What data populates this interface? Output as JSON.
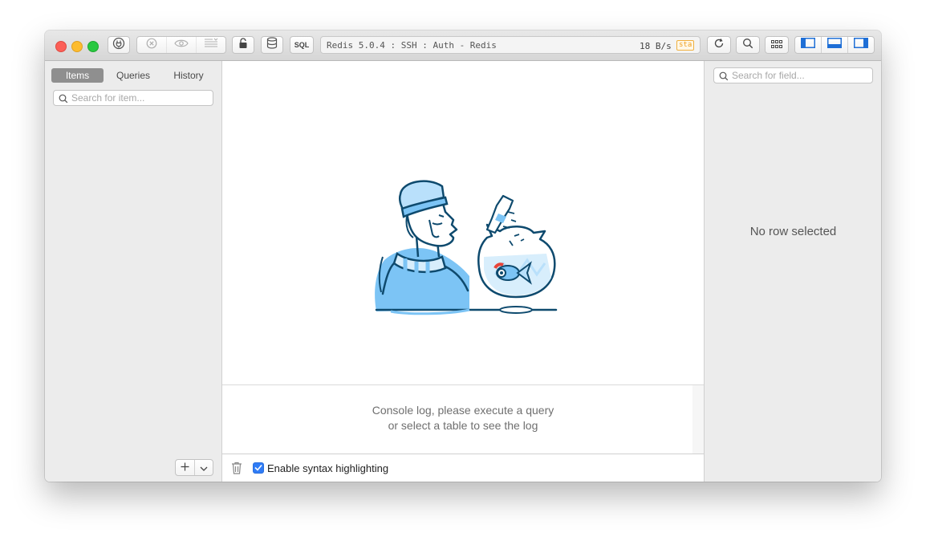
{
  "window": {
    "connection_label": "Redis 5.0.4 : SSH : Auth - Redis",
    "transfer_rate": "18 B/s",
    "env_badge": "sta",
    "env_badge_color": "#f0a020"
  },
  "toolbar": {
    "sql_label": "SQL",
    "icons": [
      "connection-icon",
      "stop-icon",
      "preview-icon",
      "format-icon",
      "lock-icon",
      "database-icon",
      "sql-icon",
      "refresh-icon",
      "search-icon",
      "grid-icon",
      "toggle-left-panel-icon",
      "toggle-bottom-panel-icon",
      "toggle-right-panel-icon"
    ]
  },
  "sidebar": {
    "tabs": [
      {
        "label": "Items",
        "active": true
      },
      {
        "label": "Queries",
        "active": false
      },
      {
        "label": "History",
        "active": false
      }
    ],
    "search_placeholder": "Search for item..."
  },
  "main": {
    "illustration": "man-with-fishbowl-illustration"
  },
  "console": {
    "line1": "Console log, please execute a query",
    "line2": "or select a table to see the log"
  },
  "footer": {
    "syntax_label": "Enable syntax highlighting",
    "syntax_checked": true
  },
  "right_panel": {
    "search_placeholder": "Search for field...",
    "empty_message": "No row selected"
  },
  "colors": {
    "accent": "#2f7cf6",
    "illustration_line": "#0e4a6e",
    "illustration_fill": "#7cc4f5"
  }
}
